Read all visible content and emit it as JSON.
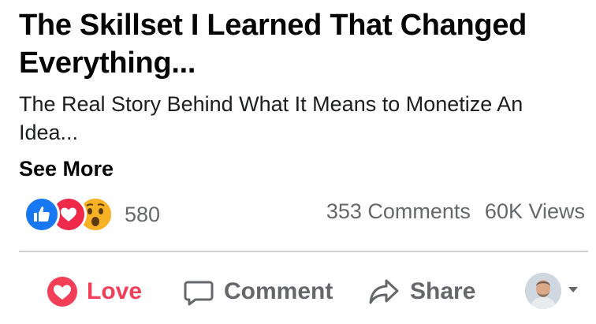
{
  "post": {
    "title": "The Skillset I Learned That Changed Everything...",
    "subtitle": "The Real Story Behind What It Means to Monetize An Idea...",
    "see_more": "See More"
  },
  "engagement": {
    "reaction_icons": [
      "like-icon",
      "love-icon",
      "wow-icon"
    ],
    "reaction_count": "580",
    "comments": "353 Comments",
    "views": "60K Views"
  },
  "actions": {
    "love": "Love",
    "comment": "Comment",
    "share": "Share"
  },
  "colors": {
    "love_accent": "#f33e58",
    "like_blue": "#1877f2",
    "muted_text": "#65676b"
  }
}
